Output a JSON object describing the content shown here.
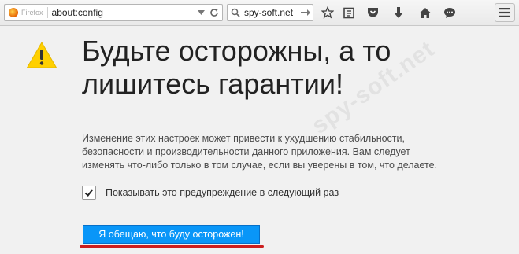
{
  "toolbar": {
    "brand": "Firefox",
    "url": "about:config",
    "search_value": "spy-soft.net",
    "buttons": [
      "star-icon",
      "reading-list-icon",
      "pocket-icon",
      "download-icon",
      "home-icon",
      "chat-icon",
      "hamburger-menu-icon"
    ]
  },
  "warning": {
    "title": "Будьте осторожны, а то лишитесь гарантии!",
    "description": "Изменение этих настроек может привести к ухудшению стабильности, безопасности и производительности данного приложения. Вам следует изменять что-либо только в том случае, если вы уверены в том, что делаете.",
    "checkbox_label": "Показывать это предупреждение в следующий раз",
    "checkbox_checked": true,
    "button_label": "Я обещаю, что буду осторожен!"
  },
  "watermark": "spy-soft.net",
  "colors": {
    "accent": "#0996f8",
    "underline": "#cc1f1f",
    "warning": "#ffd000"
  }
}
